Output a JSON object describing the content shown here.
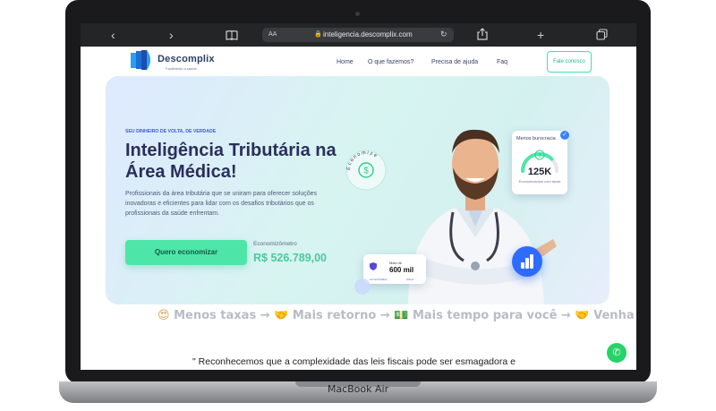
{
  "browser": {
    "url_prefix": "AA",
    "url": "inteligencia.descomplix.com",
    "icons": [
      "chevron-left-icon",
      "chevron-right-icon",
      "book-icon",
      "lock-icon",
      "reload-icon",
      "share-icon",
      "plus-icon",
      "tabs-icon"
    ]
  },
  "device": {
    "model": "MacBook Air"
  },
  "header": {
    "logo_text": "Descomplix",
    "logo_tagline": "Facilitando a saúde",
    "nav": [
      "Home",
      "O que fazemos?",
      "Precisa de ajuda",
      "Faq"
    ],
    "cta": "Fale conosco"
  },
  "hero": {
    "eyebrow": "SEU DINHEIRO DE VOLTA, DE VERDADE",
    "title": "Inteligência Tributária na Área Médica!",
    "description": "Profissionais da área tributária que se uniram para oferecer soluções inovadoras e eficientes para lidar com os desafios tributários que os profissionais da saúde enfrentam.",
    "cta": "Quero economizar",
    "meter_label": "Economizômetro",
    "meter_value": "R$ 526.789,00",
    "stamp_text": "Economize"
  },
  "cards": {
    "burocracia": {
      "title": "Menos burocracia",
      "value": "125K",
      "subtitle": "Economizamos com taxas",
      "gauge_fraction": 0.75
    },
    "leads": {
      "label": "Mais de",
      "value": "600 mil",
      "footer_left": "economizados",
      "footer_right": "Ativos"
    }
  },
  "marquee": {
    "items": [
      {
        "emoji": "😍",
        "text": "Menos taxas"
      },
      {
        "emoji": "🤝",
        "text": "Mais retorno"
      },
      {
        "emoji": "💵",
        "text": "Mais tempo para você"
      },
      {
        "emoji": "🤝",
        "text": "Venha para"
      }
    ],
    "arrow": "→"
  },
  "quote": "\" Reconhecemos que a complexidade das leis fiscais pode ser esmagadora e",
  "colors": {
    "accent_green": "#4ee6a8",
    "brand_navy": "#2a2f5c",
    "link_blue": "#3b5bdb",
    "whatsapp": "#25d366"
  }
}
